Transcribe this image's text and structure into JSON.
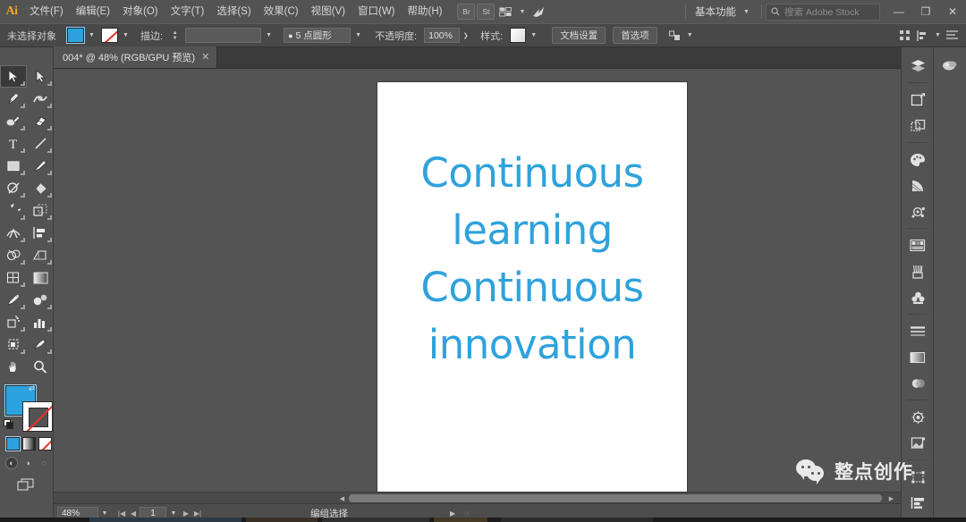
{
  "app": {
    "logo": "Ai",
    "accent_fill": "#2da3de",
    "chrome_bg": "#535353",
    "canvas_bg": "#545454"
  },
  "menubar": {
    "items": [
      {
        "label": "文件(F)",
        "name": "menu-file"
      },
      {
        "label": "编辑(E)",
        "name": "menu-edit"
      },
      {
        "label": "对象(O)",
        "name": "menu-object"
      },
      {
        "label": "文字(T)",
        "name": "menu-type"
      },
      {
        "label": "选择(S)",
        "name": "menu-select"
      },
      {
        "label": "效果(C)",
        "name": "menu-effect"
      },
      {
        "label": "视图(V)",
        "name": "menu-view"
      },
      {
        "label": "窗口(W)",
        "name": "menu-window"
      },
      {
        "label": "帮助(H)",
        "name": "menu-help"
      }
    ],
    "bridge_label": "Br",
    "stock_label": "St",
    "arrange_label": "▥",
    "workspace": "基本功能",
    "search_placeholder": "搜索 Adobe Stock",
    "minimize": "—",
    "maximize": "❐",
    "close": "✕"
  },
  "controlbar": {
    "selection_label": "未选择对象",
    "stroke_label": "描边:",
    "stroke_profile": "5 点圆形",
    "opacity_label": "不透明度:",
    "opacity_value": "100%",
    "style_label": "样式:",
    "doc_setup": "文档设置",
    "preferences": "首选项",
    "fill_color": "#2da3de",
    "stroke_color": "none"
  },
  "tab": {
    "title": "004* @ 48% (RGB/GPU 预览)",
    "close": "✕"
  },
  "toolbar": {
    "tools": [
      {
        "name": "tool-selection",
        "label": "选择工具",
        "active": true
      },
      {
        "name": "tool-direct-selection",
        "label": "直接选择工具",
        "active": false
      },
      {
        "name": "tool-pen",
        "label": "钢笔工具",
        "active": false
      },
      {
        "name": "tool-curvature",
        "label": "曲率工具",
        "active": false
      },
      {
        "name": "tool-blob-brush",
        "label": "斑点画笔工具",
        "active": false
      },
      {
        "name": "tool-eraser",
        "label": "橡皮擦工具",
        "active": false
      },
      {
        "name": "tool-type",
        "label": "文字工具",
        "active": false
      },
      {
        "name": "tool-line-segment",
        "label": "直线段工具",
        "active": false
      },
      {
        "name": "tool-rectangle",
        "label": "矩形工具",
        "active": false
      },
      {
        "name": "tool-paintbrush",
        "label": "画笔工具",
        "active": false
      },
      {
        "name": "tool-shaper",
        "label": "Shaper 工具",
        "active": false
      },
      {
        "name": "tool-gradient",
        "label": "渐变工具",
        "active": false
      },
      {
        "name": "tool-rotate",
        "label": "旋转工具",
        "active": false
      },
      {
        "name": "tool-scale",
        "label": "缩放工具",
        "active": false
      },
      {
        "name": "tool-width",
        "label": "宽度工具",
        "active": false
      },
      {
        "name": "tool-free-transform",
        "label": "自由变换工具",
        "active": false
      },
      {
        "name": "tool-shape-builder",
        "label": "形状生成器工具",
        "active": false
      },
      {
        "name": "tool-perspective-grid",
        "label": "透视网格工具",
        "active": false
      },
      {
        "name": "tool-mesh",
        "label": "网格工具",
        "active": false
      },
      {
        "name": "tool-gradient-swatch",
        "label": "渐变",
        "active": false
      },
      {
        "name": "tool-eyedropper",
        "label": "吸管工具",
        "active": false
      },
      {
        "name": "tool-blend",
        "label": "混合工具",
        "active": false
      },
      {
        "name": "tool-symbol-sprayer",
        "label": "符号喷枪工具",
        "active": false
      },
      {
        "name": "tool-column-graph",
        "label": "柱形图工具",
        "active": false
      },
      {
        "name": "tool-artboard",
        "label": "画板工具",
        "active": false
      },
      {
        "name": "tool-slice",
        "label": "切片工具",
        "active": false
      },
      {
        "name": "tool-hand",
        "label": "抓手工具",
        "active": false
      },
      {
        "name": "tool-zoom",
        "label": "缩放显示工具",
        "active": false
      }
    ],
    "swap_icon": "⇄",
    "draw_modes": [
      "正常绘图",
      "背面绘图",
      "内部绘图"
    ],
    "screen_mode": "更改屏幕模式"
  },
  "artboard": {
    "text_lines": [
      "Continuous",
      "learning",
      "Continuous",
      "innovation"
    ],
    "text_color": "#2fa2dc"
  },
  "statusbar": {
    "zoom": "48%",
    "page": "1",
    "tool_name": "编组选择",
    "nav_first": "|◀",
    "nav_prev": "◀",
    "nav_next": "▶",
    "nav_last": "▶|"
  },
  "dock": {
    "col1": [
      {
        "name": "panel-layers-icon",
        "label": "图层"
      },
      {
        "name": "panel-libraries-icon",
        "label": "库"
      },
      {
        "name": "panel-artboards-icon",
        "label": "画板"
      },
      {
        "name": "panel-color-icon",
        "label": "颜色"
      },
      {
        "name": "panel-color-guide-icon",
        "label": "颜色参考"
      },
      {
        "name": "panel-recolor-icon",
        "label": "重新着色"
      },
      {
        "name": "panel-swatches-icon",
        "label": "色板"
      },
      {
        "name": "panel-brushes-icon",
        "label": "画笔"
      },
      {
        "name": "panel-symbols-icon",
        "label": "符号"
      },
      {
        "name": "panel-stroke-icon",
        "label": "描边"
      },
      {
        "name": "panel-gradient-icon",
        "label": "渐变"
      },
      {
        "name": "panel-transparency-icon",
        "label": "透明度"
      },
      {
        "name": "panel-appearance-icon",
        "label": "外观"
      },
      {
        "name": "panel-graphic-styles-icon",
        "label": "图形样式"
      },
      {
        "name": "panel-transform-icon",
        "label": "变换"
      },
      {
        "name": "panel-align-icon",
        "label": "对齐"
      }
    ],
    "col2": [
      {
        "name": "panel-cc-libraries-icon",
        "label": "CC 库"
      }
    ]
  },
  "watermark": {
    "text": "整点创作",
    "logo": "wechat-icon"
  }
}
